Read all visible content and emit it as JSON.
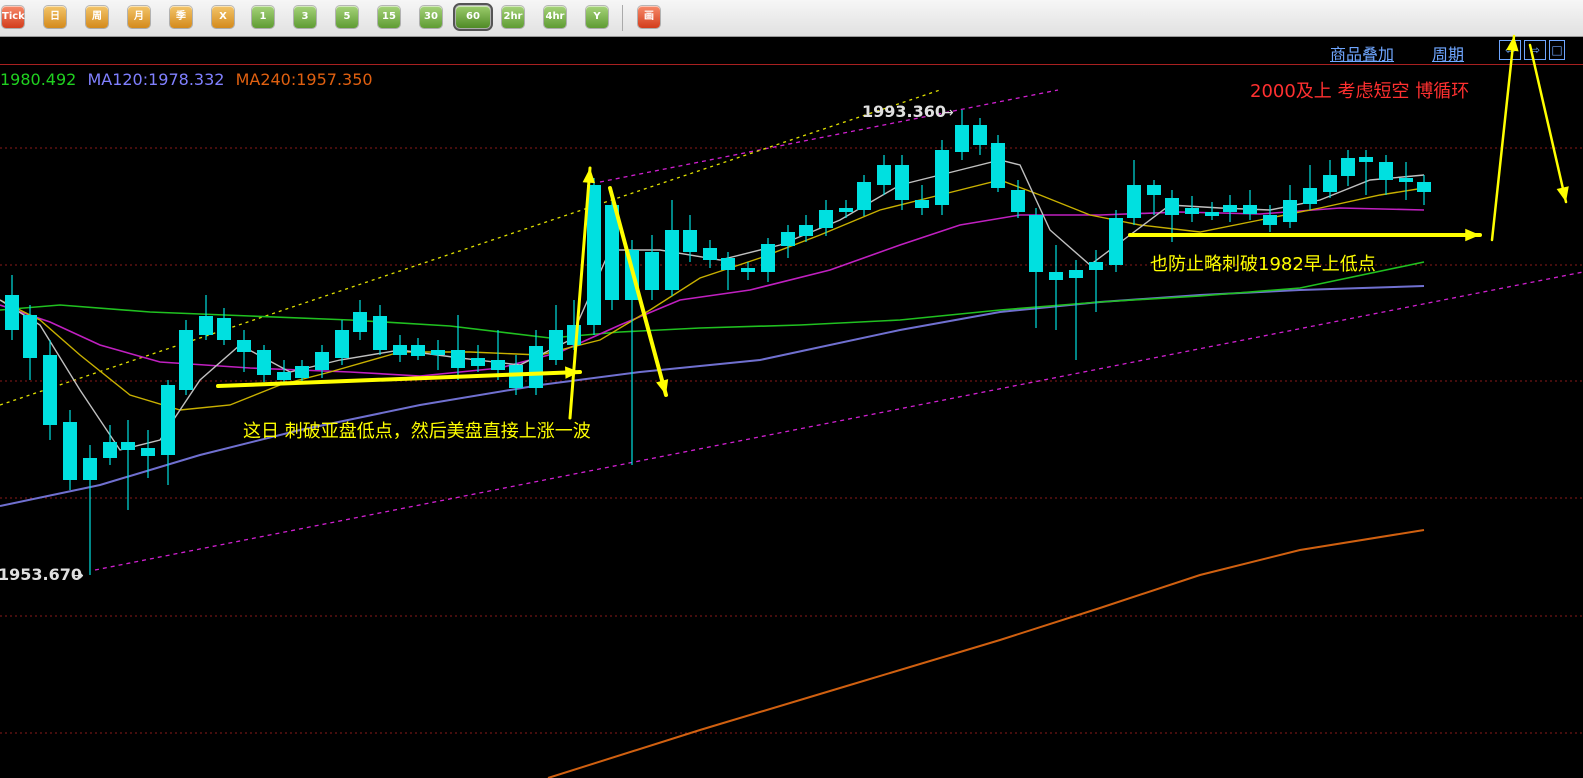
{
  "toolbar": {
    "buttons": [
      {
        "label": "Tick",
        "style": "red"
      },
      {
        "label": "日",
        "style": "orange"
      },
      {
        "label": "周",
        "style": "orange"
      },
      {
        "label": "月",
        "style": "orange"
      },
      {
        "label": "季",
        "style": "orange"
      },
      {
        "label": "X",
        "style": "orange"
      },
      {
        "label": "1",
        "style": "green"
      },
      {
        "label": "3",
        "style": "green"
      },
      {
        "label": "5",
        "style": "green"
      },
      {
        "label": "15",
        "style": "green"
      },
      {
        "label": "30",
        "style": "green"
      },
      {
        "label": "60",
        "style": "active"
      },
      {
        "label": "2hr",
        "style": "green"
      },
      {
        "label": "4hr",
        "style": "green"
      },
      {
        "label": "Y",
        "style": "green"
      },
      {
        "label": "画",
        "style": "red"
      }
    ]
  },
  "header": {
    "overlay_link": "商品叠加",
    "period_link": "周期",
    "nav_icons": [
      "arrow-left-icon",
      "arrow-right-icon",
      "window-icon"
    ]
  },
  "ma_legend": [
    {
      "text": "1980.492",
      "color": "#20d020"
    },
    {
      "text": "MA120:1978.332",
      "color": "#8080ff"
    },
    {
      "text": "MA240:1957.350",
      "color": "#e06010"
    }
  ],
  "price_marks": {
    "high": "1993.360",
    "low": "1953.670"
  },
  "annotations": {
    "top_right": "2000及上 考虑短空 博循环",
    "middle_right": "也防止略刺破1982早上低点",
    "middle_left": "这日 刺破亚盘低点，然后美盘直接上涨一波"
  },
  "colors": {
    "up_candle": "#e03030",
    "down_candle": "#00e0e0",
    "annotation_yellow": "#ffff00",
    "annotation_red": "#ff3030",
    "channel_magenta": "#d020d0",
    "channel_yellow": "#e0e000",
    "grid": "#8a1a1a"
  }
}
